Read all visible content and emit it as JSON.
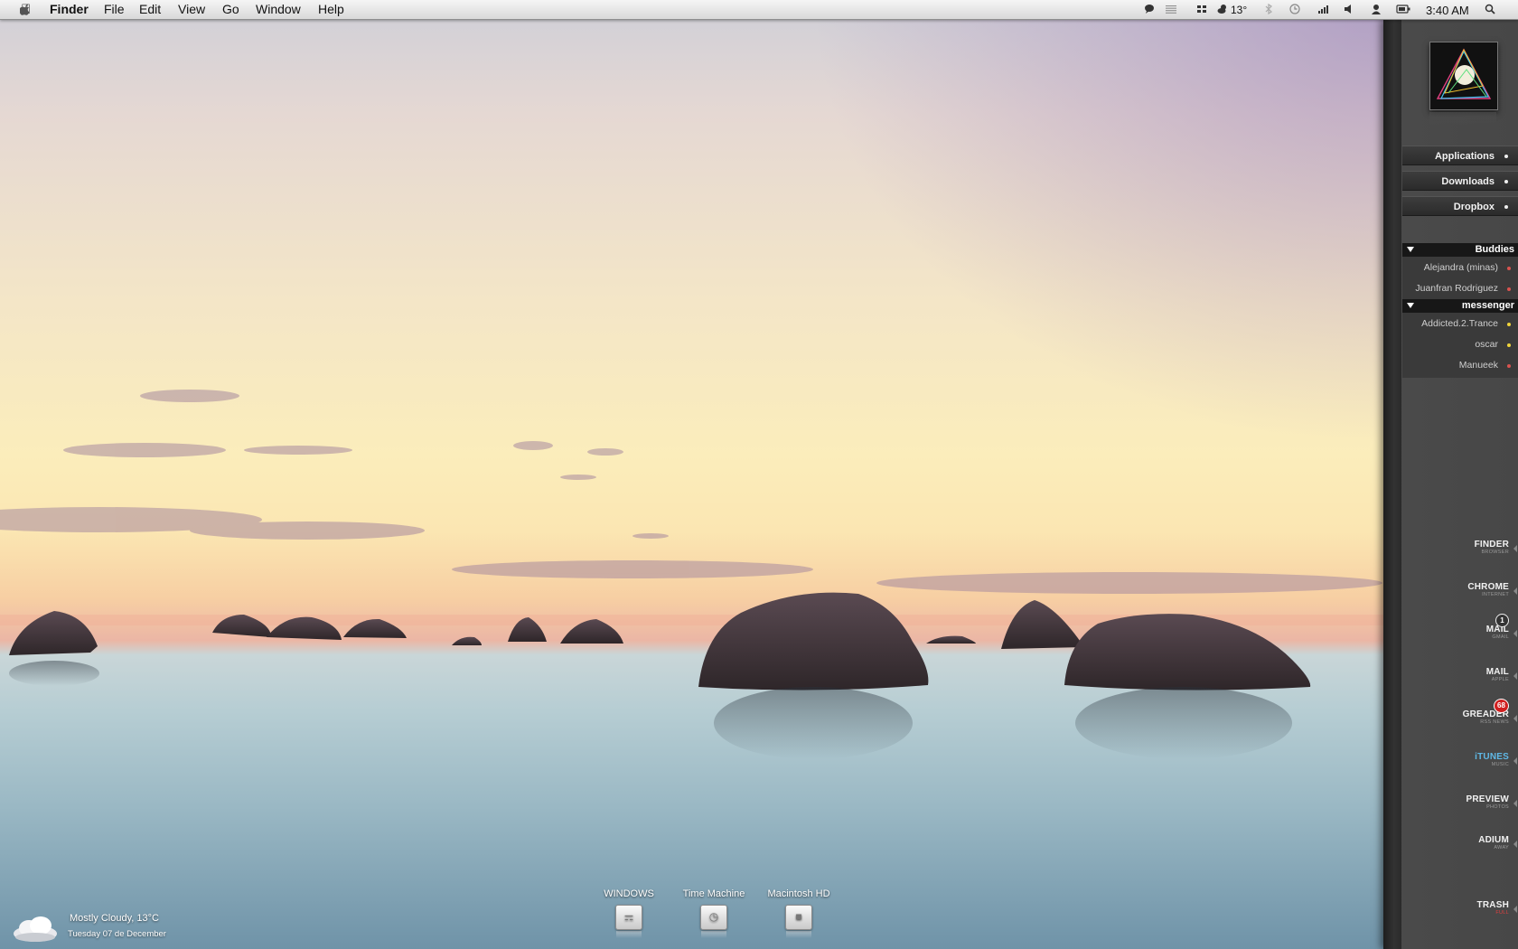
{
  "menubar": {
    "app_name": "Finder",
    "menus": [
      "File",
      "Edit",
      "View",
      "Go",
      "Window",
      "Help"
    ],
    "status": {
      "weather_temp": "13°",
      "clock": "3:40 AM"
    },
    "icons": [
      "apple-icon",
      "chat-icon",
      "list-icon",
      "dropbox-icon",
      "weather-icon",
      "bluetooth-icon",
      "time-machine-icon",
      "wifi-icon",
      "volume-icon",
      "user-icon",
      "battery-icon",
      "spotlight-icon"
    ]
  },
  "sidebar": {
    "stacks": [
      {
        "label": "Applications"
      },
      {
        "label": "Downloads"
      },
      {
        "label": "Dropbox"
      }
    ],
    "buddy_groups": [
      {
        "name": "Buddies",
        "buddies": [
          {
            "name": "Alejandra (minas)",
            "status_color": "#d9534f"
          },
          {
            "name": "Juanfran Rodriguez",
            "status_color": "#d9534f"
          }
        ]
      },
      {
        "name": "messenger",
        "buddies": [
          {
            "name": "Addicted.2.Trance",
            "status_color": "#f0d43a"
          },
          {
            "name": "oscar",
            "status_color": "#f0d43a"
          },
          {
            "name": "Manueek",
            "status_color": "#d9534f"
          }
        ]
      }
    ],
    "apps": [
      {
        "name": "FINDER",
        "sub": "BROWSER",
        "badge": ""
      },
      {
        "name": "CHROME",
        "sub": "INTERNET",
        "badge": ""
      },
      {
        "name": "MAIL",
        "sub": "GMAIL",
        "badge": "1"
      },
      {
        "name": "MAIL",
        "sub": "APPLE",
        "badge": ""
      },
      {
        "name": "GREADER",
        "sub": "RSS NEWS",
        "badge": "68"
      },
      {
        "name": "iTUNES",
        "sub": "MUSIC",
        "badge": ""
      },
      {
        "name": "PREVIEW",
        "sub": "PHOTOS",
        "badge": ""
      },
      {
        "name": "ADIUM",
        "sub": "AWAY",
        "badge": ""
      },
      {
        "name": "TRASH",
        "sub": "FULL",
        "badge": ""
      }
    ],
    "colors": {
      "itunes": "#5fb8e6",
      "trash_sub": "#e04040",
      "badge_red": "#d02020"
    }
  },
  "desktop": {
    "drives": [
      {
        "label": "WINDOWS",
        "icon": "windows-drive-icon"
      },
      {
        "label": "Time Machine",
        "icon": "time-machine-drive-icon"
      },
      {
        "label": "Macintosh HD",
        "icon": "macintosh-hd-icon"
      }
    ],
    "weather": {
      "condition": "Mostly Cloudy, 13°C",
      "date": "Tuesday 07 de December"
    }
  }
}
